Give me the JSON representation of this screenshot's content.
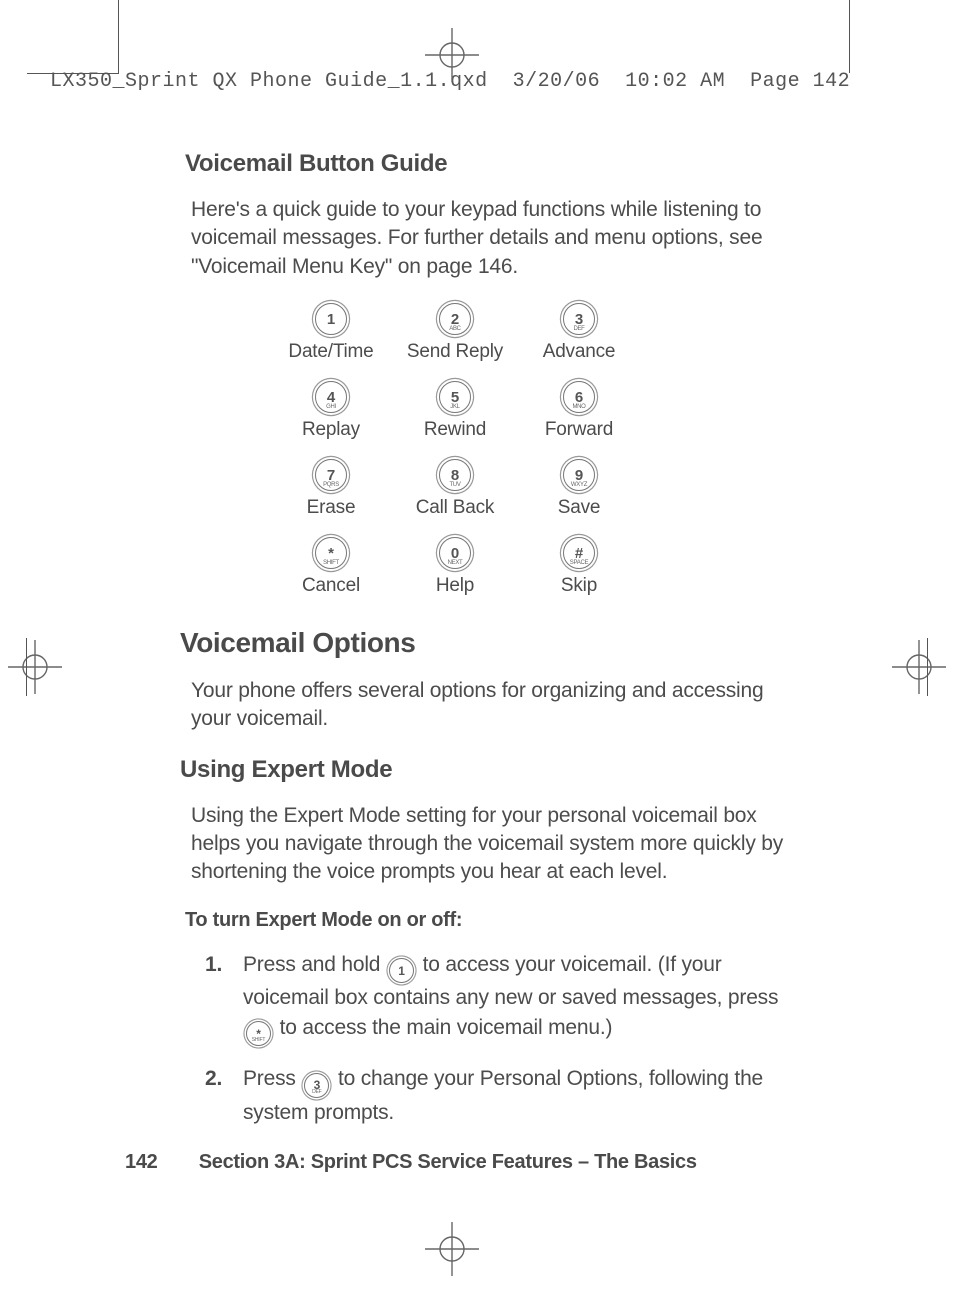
{
  "header": {
    "filename": "LX350_Sprint QX Phone Guide_1.1.qxd",
    "date": "3/20/06",
    "time": "10:02 AM",
    "page_label": "Page 142"
  },
  "sections": {
    "button_guide_title": "Voicemail Button Guide",
    "button_guide_intro": "Here's a quick guide to your keypad functions while listening to voicemail messages. For further details and menu options, see \"Voicemail Menu Key\" on page 146.",
    "options_title": "Voicemail Options",
    "options_intro": "Your phone offers several options for organizing and accessing your voicemail.",
    "expert_title": "Using Expert Mode",
    "expert_intro": "Using the Expert Mode setting for your personal voicemail box helps you navigate through the voicemail system more quickly by shortening the voice prompts you hear at each level.",
    "expert_lead": "To turn Expert Mode on or off:"
  },
  "keypad": [
    [
      {
        "key": "1",
        "sub": "",
        "label": "Date/Time"
      },
      {
        "key": "2",
        "sub": "ABC",
        "label": "Send Reply"
      },
      {
        "key": "3",
        "sub": "DEF",
        "label": "Advance"
      }
    ],
    [
      {
        "key": "4",
        "sub": "GHI",
        "label": "Replay"
      },
      {
        "key": "5",
        "sub": "JKL",
        "label": "Rewind"
      },
      {
        "key": "6",
        "sub": "MNO",
        "label": "Forward"
      }
    ],
    [
      {
        "key": "7",
        "sub": "PQRS",
        "label": "Erase"
      },
      {
        "key": "8",
        "sub": "TUV",
        "label": "Call Back"
      },
      {
        "key": "9",
        "sub": "WXYZ",
        "label": "Save"
      }
    ],
    [
      {
        "key": "*",
        "sub": "SHIFT",
        "label": "Cancel"
      },
      {
        "key": "0",
        "sub": "NEXT",
        "label": "Help"
      },
      {
        "key": "#",
        "sub": "SPACE",
        "label": "Skip"
      }
    ]
  ],
  "steps": [
    {
      "num": "1.",
      "pre": "Press and hold ",
      "btn1": {
        "key": "1",
        "sub": ""
      },
      "mid": " to access your voicemail. (If your voicemail box contains any new or saved messages, press ",
      "btn2": {
        "key": "*",
        "sub": "SHIFT"
      },
      "post": " to access the main voicemail menu.)"
    },
    {
      "num": "2.",
      "pre": "Press ",
      "btn1": {
        "key": "3",
        "sub": "DEF"
      },
      "mid": " to change your Personal Options, following the system prompts.",
      "btn2": null,
      "post": ""
    }
  ],
  "footer": {
    "page_number": "142",
    "section_label": "Section 3A: Sprint PCS Service Features – The Basics"
  }
}
